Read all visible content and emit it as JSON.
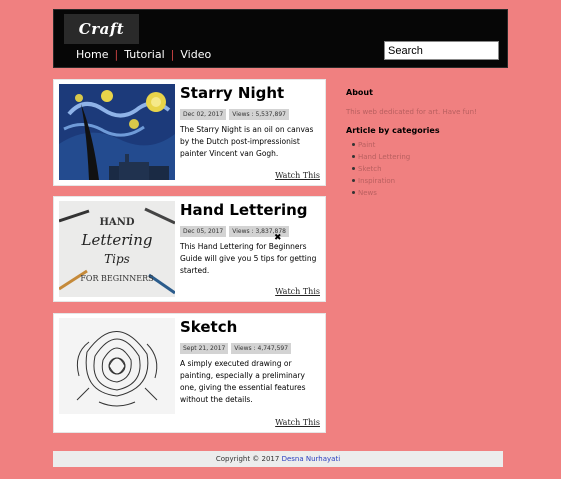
{
  "header": {
    "logo_text": "Craft",
    "nav": [
      "Home",
      "Tutorial",
      "Video"
    ],
    "search_placeholder": "Search"
  },
  "articles": [
    {
      "title": "Starry Night",
      "date": "Dec 02, 2017",
      "views": "Views : 5,537,897",
      "desc": "The Starry Night is an oil on canvas by the Dutch post-impressionist painter Vincent van Gogh.",
      "cta": "Watch This"
    },
    {
      "title": "Hand Lettering",
      "date": "Dec 05, 2017",
      "views": "Views : 3,837,878",
      "desc": "This Hand Lettering for Beginners Guide will give you 5 tips for getting started.",
      "cta": "Watch This",
      "thumb_text": [
        "HAND",
        "Lettering",
        "Tips",
        "FOR BEGINNERS"
      ]
    },
    {
      "title": "Sketch",
      "date": "Sept 21, 2017",
      "views": "Views : 4,747,597",
      "desc": "A simply executed drawing or painting, especially a preliminary one, giving the essential features without the details.",
      "cta": "Watch This"
    }
  ],
  "sidebar": {
    "about_title": "About",
    "about_text": "This web dedicated for art. Have fun!",
    "categories_title": "Article by categories",
    "categories": [
      "Paint",
      "Hand Lettering",
      "Sketch",
      "Inspiration",
      "News"
    ]
  },
  "footer": {
    "copyright": "Copyright © 2017",
    "author": "Desna Nurhayati"
  },
  "colors": {
    "page_bg": "#f08080",
    "header_bg": "#060606",
    "category_link": "#b85f5f",
    "footer_link": "#2a3fbf"
  }
}
